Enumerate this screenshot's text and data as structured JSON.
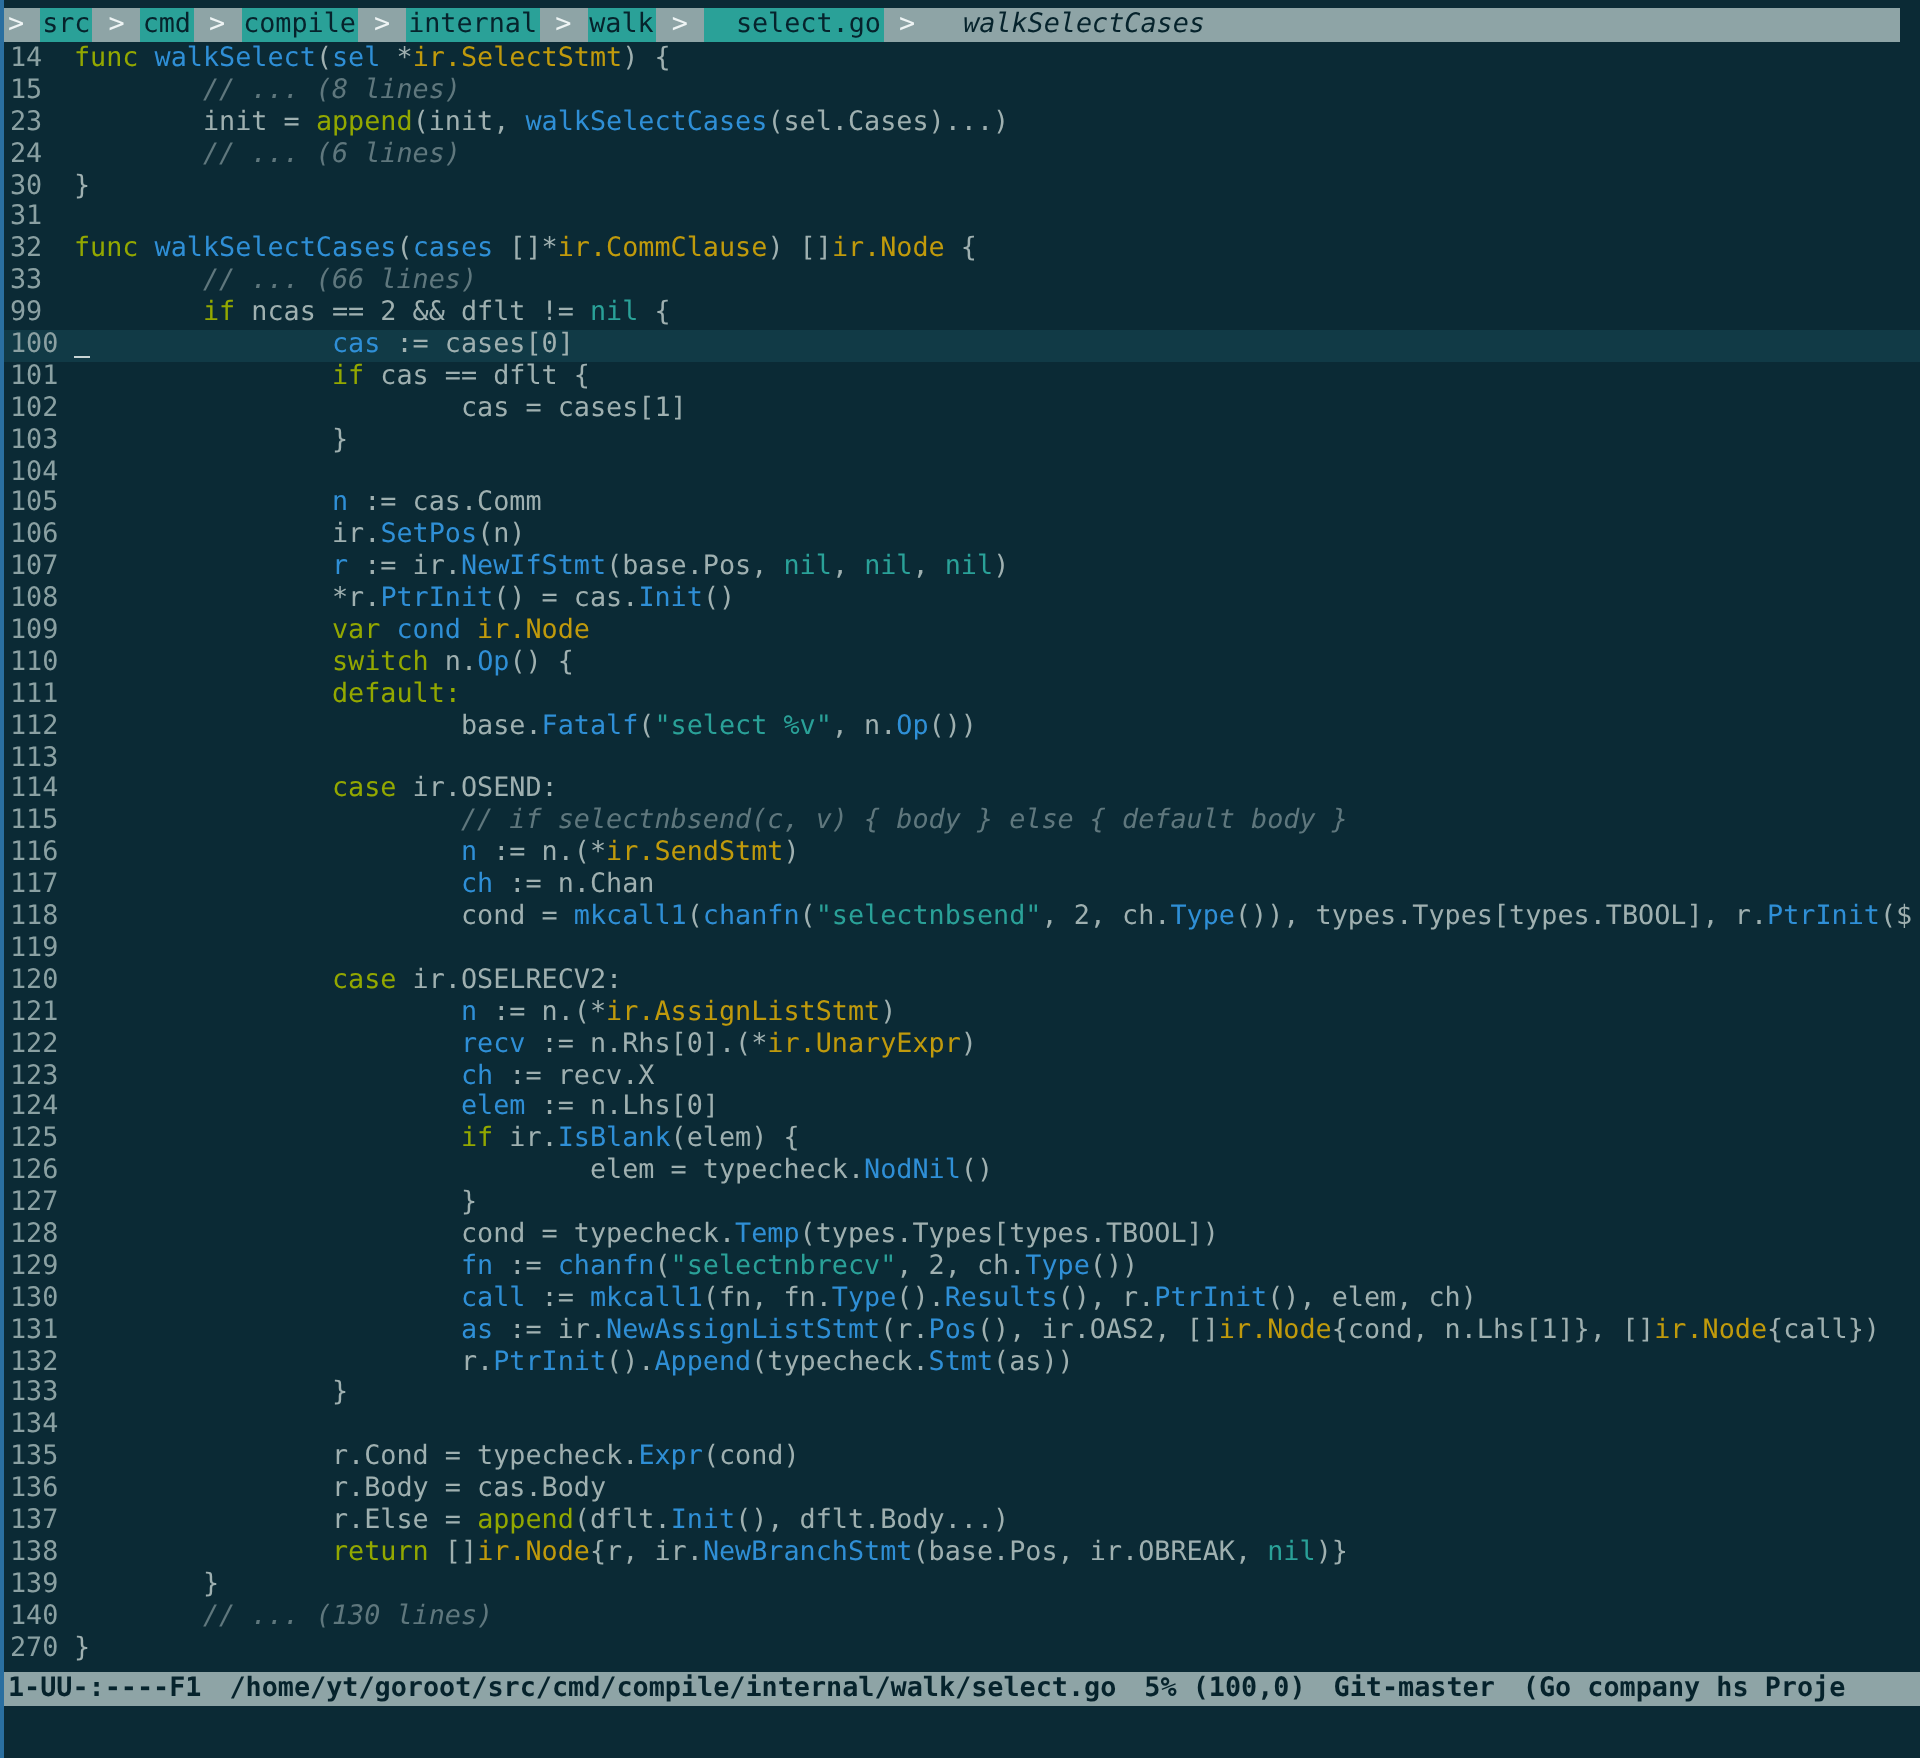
{
  "breadcrumb": [
    {
      "kind": "separator",
      "text": ">"
    },
    {
      "kind": "dir",
      "text": "src"
    },
    {
      "kind": "separator",
      "text": ">"
    },
    {
      "kind": "dir",
      "text": "cmd"
    },
    {
      "kind": "separator",
      "text": ">"
    },
    {
      "kind": "dir",
      "text": "compile"
    },
    {
      "kind": "separator",
      "text": ">"
    },
    {
      "kind": "dir",
      "text": "internal"
    },
    {
      "kind": "separator",
      "text": ">"
    },
    {
      "kind": "dir",
      "text": "walk"
    },
    {
      "kind": "separator",
      "text": ">"
    },
    {
      "kind": "file",
      "text": "select.go"
    },
    {
      "kind": "separator",
      "text": ">"
    },
    {
      "kind": "symbol",
      "text": "walkSelectCases"
    }
  ],
  "lines": [
    {
      "number": "14",
      "current": false,
      "tokens": [
        {
          "kind": "keyword",
          "text": "func"
        },
        {
          "kind": "name",
          "text": " walkSelect"
        },
        {
          "kind": "plain",
          "text": "("
        },
        {
          "kind": "name",
          "text": "sel"
        },
        {
          "kind": "plain",
          "text": " *"
        },
        {
          "kind": "type",
          "text": "ir.SelectStmt"
        },
        {
          "kind": "plain",
          "text": ") {"
        }
      ]
    },
    {
      "number": "15",
      "current": false,
      "tokens": [
        {
          "kind": "comment",
          "text": "\t// ... (8 lines)"
        }
      ]
    },
    {
      "number": "23",
      "current": false,
      "tokens": [
        {
          "kind": "plain",
          "text": "\tinit = "
        },
        {
          "kind": "keyword",
          "text": "append"
        },
        {
          "kind": "plain",
          "text": "(init, "
        },
        {
          "kind": "name",
          "text": "walkSelectCases"
        },
        {
          "kind": "plain",
          "text": "(sel.Cases)...)"
        }
      ]
    },
    {
      "number": "24",
      "current": false,
      "tokens": [
        {
          "kind": "comment",
          "text": "\t// ... (6 lines)"
        }
      ]
    },
    {
      "number": "30",
      "current": false,
      "tokens": [
        {
          "kind": "plain",
          "text": "}"
        }
      ]
    },
    {
      "number": "31",
      "current": false
    },
    {
      "number": "32",
      "current": false,
      "tokens": [
        {
          "kind": "keyword",
          "text": "func"
        },
        {
          "kind": "name",
          "text": " walkSelectCases"
        },
        {
          "kind": "plain",
          "text": "("
        },
        {
          "kind": "name",
          "text": "cases"
        },
        {
          "kind": "plain",
          "text": " []*"
        },
        {
          "kind": "type",
          "text": "ir.CommClause"
        },
        {
          "kind": "plain",
          "text": ") []"
        },
        {
          "kind": "type",
          "text": "ir.Node"
        },
        {
          "kind": "plain",
          "text": " {"
        }
      ]
    },
    {
      "number": "33",
      "current": false,
      "tokens": [
        {
          "kind": "comment",
          "text": "\t// ... (66 lines)"
        }
      ]
    },
    {
      "number": "99",
      "current": false,
      "tokens": [
        {
          "kind": "keyword",
          "text": "\tif"
        },
        {
          "kind": "plain",
          "text": " ncas == 2 && dflt != "
        },
        {
          "kind": "literal",
          "text": "nil"
        },
        {
          "kind": "plain",
          "text": " {"
        }
      ]
    },
    {
      "number": "100",
      "current": true,
      "tokens": [
        {
          "kind": "name",
          "text": "\t\tcas"
        },
        {
          "kind": "plain",
          "text": " := cases[0]"
        }
      ]
    },
    {
      "number": "101",
      "current": false,
      "tokens": [
        {
          "kind": "keyword",
          "text": "\t\tif"
        },
        {
          "kind": "plain",
          "text": " cas == dflt {"
        }
      ]
    },
    {
      "number": "102",
      "current": false,
      "tokens": [
        {
          "kind": "plain",
          "text": "\t\t\tcas = cases[1]"
        }
      ]
    },
    {
      "number": "103",
      "current": false,
      "tokens": [
        {
          "kind": "plain",
          "text": "\t\t}"
        }
      ]
    },
    {
      "number": "104",
      "current": false
    },
    {
      "number": "105",
      "current": false,
      "tokens": [
        {
          "kind": "name",
          "text": "\t\tn"
        },
        {
          "kind": "plain",
          "text": " := cas.Comm"
        }
      ]
    },
    {
      "number": "106",
      "current": false,
      "tokens": [
        {
          "kind": "plain",
          "text": "\t\tir."
        },
        {
          "kind": "name",
          "text": "SetPos"
        },
        {
          "kind": "plain",
          "text": "(n)"
        }
      ]
    },
    {
      "number": "107",
      "current": false,
      "tokens": [
        {
          "kind": "name",
          "text": "\t\tr"
        },
        {
          "kind": "plain",
          "text": " := ir."
        },
        {
          "kind": "name",
          "text": "NewIfStmt"
        },
        {
          "kind": "plain",
          "text": "(base.Pos, "
        },
        {
          "kind": "literal",
          "text": "nil"
        },
        {
          "kind": "plain",
          "text": ", "
        },
        {
          "kind": "literal",
          "text": "nil"
        },
        {
          "kind": "plain",
          "text": ", "
        },
        {
          "kind": "literal",
          "text": "nil"
        },
        {
          "kind": "plain",
          "text": ")"
        }
      ]
    },
    {
      "number": "108",
      "current": false,
      "tokens": [
        {
          "kind": "plain",
          "text": "\t\t*r."
        },
        {
          "kind": "name",
          "text": "PtrInit"
        },
        {
          "kind": "plain",
          "text": "() = cas."
        },
        {
          "kind": "name",
          "text": "Init"
        },
        {
          "kind": "plain",
          "text": "()"
        }
      ]
    },
    {
      "number": "109",
      "current": false,
      "tokens": [
        {
          "kind": "keyword",
          "text": "\t\tvar"
        },
        {
          "kind": "name",
          "text": " cond"
        },
        {
          "kind": "type",
          "text": " ir.Node"
        }
      ]
    },
    {
      "number": "110",
      "current": false,
      "tokens": [
        {
          "kind": "keyword",
          "text": "\t\tswitch"
        },
        {
          "kind": "plain",
          "text": " n."
        },
        {
          "kind": "name",
          "text": "Op"
        },
        {
          "kind": "plain",
          "text": "() {"
        }
      ]
    },
    {
      "number": "111",
      "current": false,
      "tokens": [
        {
          "kind": "keyword",
          "text": "\t\tdefault:"
        }
      ]
    },
    {
      "number": "112",
      "current": false,
      "tokens": [
        {
          "kind": "plain",
          "text": "\t\t\tbase."
        },
        {
          "kind": "name",
          "text": "Fatalf"
        },
        {
          "kind": "plain",
          "text": "("
        },
        {
          "kind": "literal",
          "text": "\"select %v\""
        },
        {
          "kind": "plain",
          "text": ", n."
        },
        {
          "kind": "name",
          "text": "Op"
        },
        {
          "kind": "plain",
          "text": "())"
        }
      ]
    },
    {
      "number": "113",
      "current": false
    },
    {
      "number": "114",
      "current": false,
      "tokens": [
        {
          "kind": "keyword",
          "text": "\t\tcase"
        },
        {
          "kind": "plain",
          "text": " ir.OSEND:"
        }
      ]
    },
    {
      "number": "115",
      "current": false,
      "tokens": [
        {
          "kind": "comment",
          "text": "\t\t\t// if selectnbsend(c, v) { body } else { default body }"
        }
      ]
    },
    {
      "number": "116",
      "current": false,
      "tokens": [
        {
          "kind": "name",
          "text": "\t\t\tn"
        },
        {
          "kind": "plain",
          "text": " := n.(*"
        },
        {
          "kind": "type",
          "text": "ir.SendStmt"
        },
        {
          "kind": "plain",
          "text": ")"
        }
      ]
    },
    {
      "number": "117",
      "current": false,
      "tokens": [
        {
          "kind": "name",
          "text": "\t\t\tch"
        },
        {
          "kind": "plain",
          "text": " := n.Chan"
        }
      ]
    },
    {
      "number": "118",
      "current": false,
      "tokens": [
        {
          "kind": "plain",
          "text": "\t\t\tcond = "
        },
        {
          "kind": "name",
          "text": "mkcall1"
        },
        {
          "kind": "plain",
          "text": "("
        },
        {
          "kind": "name",
          "text": "chanfn"
        },
        {
          "kind": "plain",
          "text": "("
        },
        {
          "kind": "literal",
          "text": "\"selectnbsend\""
        },
        {
          "kind": "plain",
          "text": ", 2, ch."
        },
        {
          "kind": "name",
          "text": "Type"
        },
        {
          "kind": "plain",
          "text": "()), types.Types[types.TBOOL], r."
        },
        {
          "kind": "name",
          "text": "PtrInit"
        },
        {
          "kind": "plain",
          "text": "($"
        }
      ]
    },
    {
      "number": "119",
      "current": false
    },
    {
      "number": "120",
      "current": false,
      "tokens": [
        {
          "kind": "keyword",
          "text": "\t\tcase"
        },
        {
          "kind": "plain",
          "text": " ir.OSELRECV2:"
        }
      ]
    },
    {
      "number": "121",
      "current": false,
      "tokens": [
        {
          "kind": "name",
          "text": "\t\t\tn"
        },
        {
          "kind": "plain",
          "text": " := n.(*"
        },
        {
          "kind": "type",
          "text": "ir.AssignListStmt"
        },
        {
          "kind": "plain",
          "text": ")"
        }
      ]
    },
    {
      "number": "122",
      "current": false,
      "tokens": [
        {
          "kind": "name",
          "text": "\t\t\trecv"
        },
        {
          "kind": "plain",
          "text": " := n.Rhs[0].(*"
        },
        {
          "kind": "type",
          "text": "ir.UnaryExpr"
        },
        {
          "kind": "plain",
          "text": ")"
        }
      ]
    },
    {
      "number": "123",
      "current": false,
      "tokens": [
        {
          "kind": "name",
          "text": "\t\t\tch"
        },
        {
          "kind": "plain",
          "text": " := recv.X"
        }
      ]
    },
    {
      "number": "124",
      "current": false,
      "tokens": [
        {
          "kind": "name",
          "text": "\t\t\telem"
        },
        {
          "kind": "plain",
          "text": " := n.Lhs[0]"
        }
      ]
    },
    {
      "number": "125",
      "current": false,
      "tokens": [
        {
          "kind": "keyword",
          "text": "\t\t\tif"
        },
        {
          "kind": "plain",
          "text": " ir."
        },
        {
          "kind": "name",
          "text": "IsBlank"
        },
        {
          "kind": "plain",
          "text": "(elem) {"
        }
      ]
    },
    {
      "number": "126",
      "current": false,
      "tokens": [
        {
          "kind": "plain",
          "text": "\t\t\t\telem = typecheck."
        },
        {
          "kind": "name",
          "text": "NodNil"
        },
        {
          "kind": "plain",
          "text": "()"
        }
      ]
    },
    {
      "number": "127",
      "current": false,
      "tokens": [
        {
          "kind": "plain",
          "text": "\t\t\t}"
        }
      ]
    },
    {
      "number": "128",
      "current": false,
      "tokens": [
        {
          "kind": "plain",
          "text": "\t\t\tcond = typecheck."
        },
        {
          "kind": "name",
          "text": "Temp"
        },
        {
          "kind": "plain",
          "text": "(types.Types[types.TBOOL])"
        }
      ]
    },
    {
      "number": "129",
      "current": false,
      "tokens": [
        {
          "kind": "name",
          "text": "\t\t\tfn"
        },
        {
          "kind": "plain",
          "text": " := "
        },
        {
          "kind": "name",
          "text": "chanfn"
        },
        {
          "kind": "plain",
          "text": "("
        },
        {
          "kind": "literal",
          "text": "\"selectnbrecv\""
        },
        {
          "kind": "plain",
          "text": ", 2, ch."
        },
        {
          "kind": "name",
          "text": "Type"
        },
        {
          "kind": "plain",
          "text": "())"
        }
      ]
    },
    {
      "number": "130",
      "current": false,
      "tokens": [
        {
          "kind": "name",
          "text": "\t\t\tcall"
        },
        {
          "kind": "plain",
          "text": " := "
        },
        {
          "kind": "name",
          "text": "mkcall1"
        },
        {
          "kind": "plain",
          "text": "(fn, fn."
        },
        {
          "kind": "name",
          "text": "Type"
        },
        {
          "kind": "plain",
          "text": "()."
        },
        {
          "kind": "name",
          "text": "Results"
        },
        {
          "kind": "plain",
          "text": "(), r."
        },
        {
          "kind": "name",
          "text": "PtrInit"
        },
        {
          "kind": "plain",
          "text": "(), elem, ch)"
        }
      ]
    },
    {
      "number": "131",
      "current": false,
      "tokens": [
        {
          "kind": "name",
          "text": "\t\t\tas"
        },
        {
          "kind": "plain",
          "text": " := ir."
        },
        {
          "kind": "name",
          "text": "NewAssignListStmt"
        },
        {
          "kind": "plain",
          "text": "(r."
        },
        {
          "kind": "name",
          "text": "Pos"
        },
        {
          "kind": "plain",
          "text": "(), ir.OAS2, []"
        },
        {
          "kind": "type",
          "text": "ir.Node"
        },
        {
          "kind": "plain",
          "text": "{cond, n.Lhs[1]}, []"
        },
        {
          "kind": "type",
          "text": "ir.Node"
        },
        {
          "kind": "plain",
          "text": "{call})"
        }
      ]
    },
    {
      "number": "132",
      "current": false,
      "tokens": [
        {
          "kind": "plain",
          "text": "\t\t\tr."
        },
        {
          "kind": "name",
          "text": "PtrInit"
        },
        {
          "kind": "plain",
          "text": "()."
        },
        {
          "kind": "name",
          "text": "Append"
        },
        {
          "kind": "plain",
          "text": "(typecheck."
        },
        {
          "kind": "name",
          "text": "Stmt"
        },
        {
          "kind": "plain",
          "text": "(as))"
        }
      ]
    },
    {
      "number": "133",
      "current": false,
      "tokens": [
        {
          "kind": "plain",
          "text": "\t\t}"
        }
      ]
    },
    {
      "number": "134",
      "current": false
    },
    {
      "number": "135",
      "current": false,
      "tokens": [
        {
          "kind": "plain",
          "text": "\t\tr.Cond = typecheck."
        },
        {
          "kind": "name",
          "text": "Expr"
        },
        {
          "kind": "plain",
          "text": "(cond)"
        }
      ]
    },
    {
      "number": "136",
      "current": false,
      "tokens": [
        {
          "kind": "plain",
          "text": "\t\tr.Body = cas.Body"
        }
      ]
    },
    {
      "number": "137",
      "current": false,
      "tokens": [
        {
          "kind": "plain",
          "text": "\t\tr.Else = "
        },
        {
          "kind": "keyword",
          "text": "append"
        },
        {
          "kind": "plain",
          "text": "(dflt."
        },
        {
          "kind": "name",
          "text": "Init"
        },
        {
          "kind": "plain",
          "text": "(), dflt.Body...)"
        }
      ]
    },
    {
      "number": "138",
      "current": false,
      "tokens": [
        {
          "kind": "keyword",
          "text": "\t\treturn"
        },
        {
          "kind": "plain",
          "text": " []"
        },
        {
          "kind": "type",
          "text": "ir.Node"
        },
        {
          "kind": "plain",
          "text": "{r, ir."
        },
        {
          "kind": "name",
          "text": "NewBranchStmt"
        },
        {
          "kind": "plain",
          "text": "(base.Pos, ir.OBREAK, "
        },
        {
          "kind": "literal",
          "text": "nil"
        },
        {
          "kind": "plain",
          "text": ")}"
        }
      ]
    },
    {
      "number": "139",
      "current": false,
      "tokens": [
        {
          "kind": "plain",
          "text": "\t}"
        }
      ]
    },
    {
      "number": "140",
      "current": false,
      "tokens": [
        {
          "kind": "comment",
          "text": "\t// ... (130 lines)"
        }
      ]
    },
    {
      "number": "270",
      "current": false,
      "tokens": [
        {
          "kind": "plain",
          "text": "}"
        }
      ]
    }
  ],
  "mode_line": {
    "status": "1-UU-:----F1",
    "file_path": "/home/yt/goroot/src/cmd/compile/internal/walk/select.go",
    "position": "5% (100,0)",
    "branch": "Git-master",
    "modes": "(Go company hs Proje"
  }
}
